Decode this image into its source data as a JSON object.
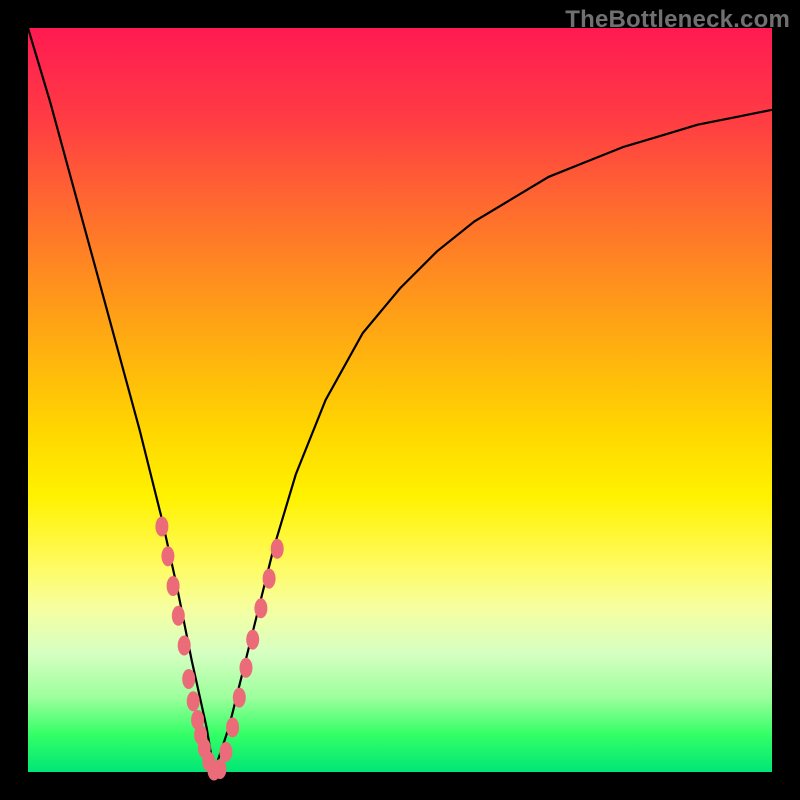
{
  "watermark": "TheBottleneck.com",
  "chart_data": {
    "type": "line",
    "title": "",
    "xlabel": "",
    "ylabel": "",
    "xlim": [
      0,
      100
    ],
    "ylim": [
      0,
      100
    ],
    "grid": false,
    "legend": false,
    "series": [
      {
        "name": "bottleneck-curve",
        "x": [
          0,
          3,
          6,
          9,
          12,
          15,
          18,
          20,
          22,
          24,
          25,
          27,
          30,
          33,
          36,
          40,
          45,
          50,
          55,
          60,
          65,
          70,
          75,
          80,
          85,
          90,
          95,
          100
        ],
        "y": [
          100,
          90,
          79,
          68,
          57,
          46,
          34,
          25,
          15,
          6,
          0,
          6,
          18,
          30,
          40,
          50,
          59,
          65,
          70,
          74,
          77,
          80,
          82,
          84,
          85.5,
          87,
          88,
          89
        ]
      }
    ],
    "markers": [
      {
        "name": "sample-points",
        "shape": "pill",
        "color": "#ec6b78",
        "points": [
          {
            "x": 18,
            "y": 33
          },
          {
            "x": 18.8,
            "y": 29
          },
          {
            "x": 19.5,
            "y": 25
          },
          {
            "x": 20.2,
            "y": 21
          },
          {
            "x": 21,
            "y": 17
          },
          {
            "x": 21.6,
            "y": 12.5
          },
          {
            "x": 22.2,
            "y": 9.5
          },
          {
            "x": 22.8,
            "y": 7
          },
          {
            "x": 23.2,
            "y": 5
          },
          {
            "x": 23.7,
            "y": 3.2
          },
          {
            "x": 24.3,
            "y": 1.4
          },
          {
            "x": 25,
            "y": 0.2
          },
          {
            "x": 25.8,
            "y": 0.4
          },
          {
            "x": 26.6,
            "y": 2.7
          },
          {
            "x": 27.5,
            "y": 6
          },
          {
            "x": 28.4,
            "y": 10
          },
          {
            "x": 29.3,
            "y": 14
          },
          {
            "x": 30.2,
            "y": 17.8
          },
          {
            "x": 31.3,
            "y": 22
          },
          {
            "x": 32.4,
            "y": 26
          },
          {
            "x": 33.5,
            "y": 30
          }
        ]
      }
    ]
  }
}
